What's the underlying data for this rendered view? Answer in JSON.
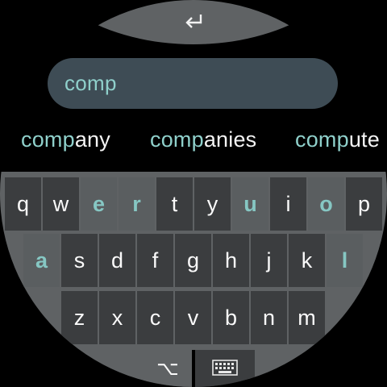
{
  "enter_key": {
    "icon": "enter-return-icon"
  },
  "input": {
    "value": "comp"
  },
  "suggestions": [
    {
      "match": "comp",
      "rest": "any"
    },
    {
      "match": "comp",
      "rest": "anies"
    },
    {
      "match": "comp",
      "rest": "ute"
    }
  ],
  "keyboard": {
    "row1": [
      "q",
      "w",
      "e",
      "r",
      "t",
      "y",
      "u",
      "i",
      "o",
      "p"
    ],
    "row2": [
      "a",
      "s",
      "d",
      "f",
      "g",
      "h",
      "j",
      "k",
      "l"
    ],
    "row3": [
      "z",
      "x",
      "c",
      "v",
      "b",
      "n",
      "m"
    ],
    "highlighted": [
      "e",
      "r",
      "u",
      "o",
      "a",
      "l"
    ],
    "alt_label": "⌥",
    "keyboard_icon": "keyboard-icon"
  },
  "colors": {
    "accent": "#8fd0cb",
    "key_bg": "#3b3d3f",
    "key_hl_bg": "#5a5e60",
    "panel": "#5f6264",
    "field_bg": "#3e4c55"
  }
}
